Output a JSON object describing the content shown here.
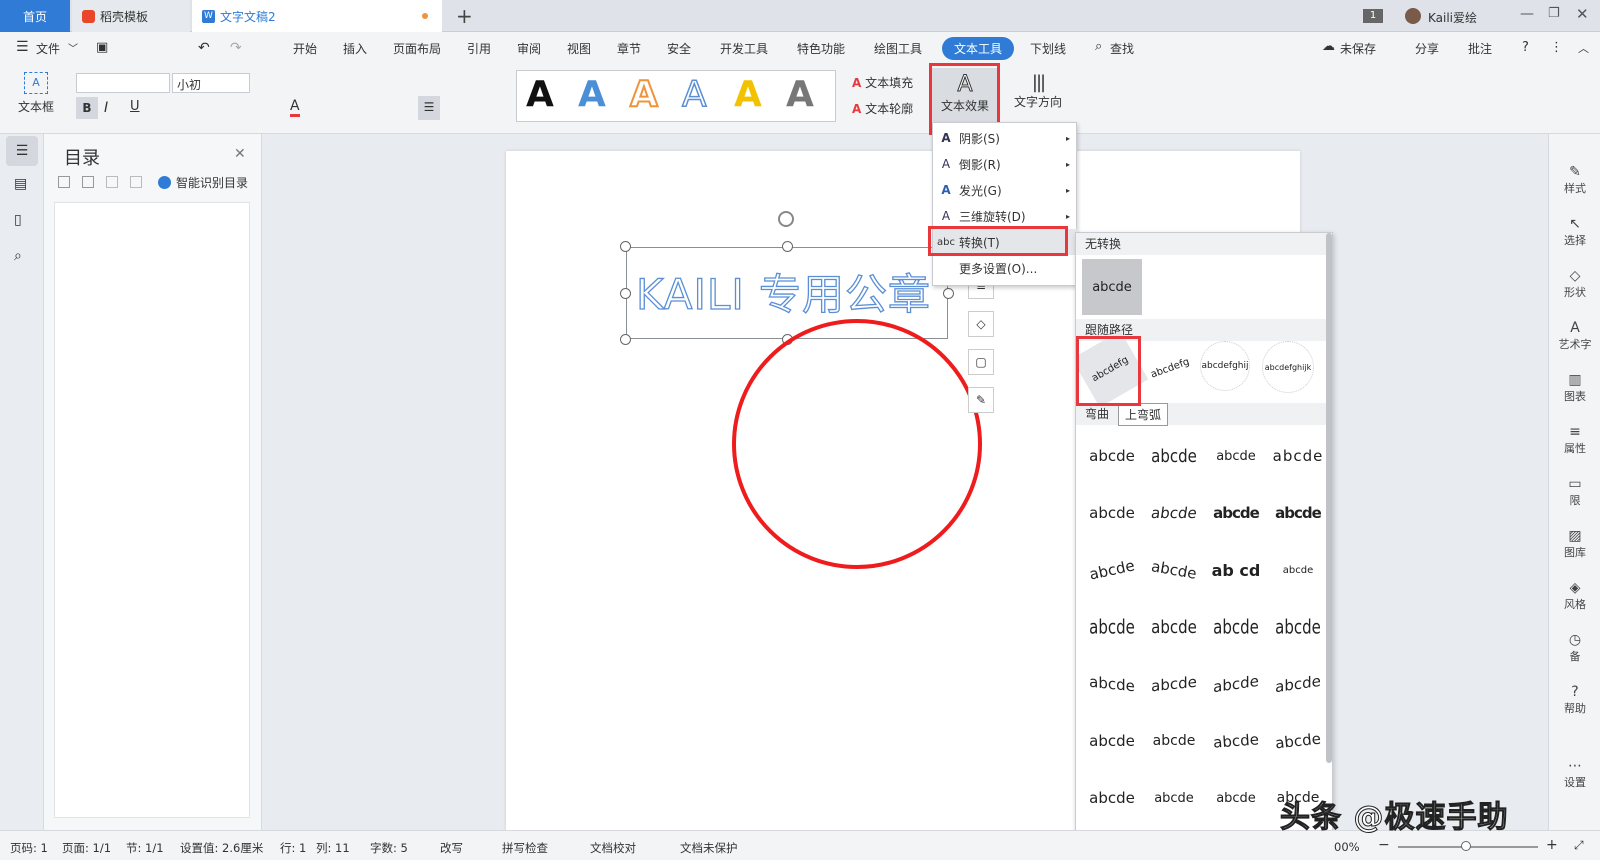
{
  "tabs": [
    {
      "label": "首页"
    },
    {
      "label": "稻壳模板"
    },
    {
      "label": "文字文稿2"
    }
  ],
  "window": {
    "badge": "1",
    "user": "Kaili爱绘"
  },
  "menu": {
    "file": "文件",
    "items": [
      "开始",
      "插入",
      "页面布局",
      "引用",
      "审阅",
      "视图",
      "章节",
      "安全",
      "开发工具",
      "特色功能",
      "绘图工具",
      "文本工具",
      "下划线"
    ],
    "search": "查找",
    "unsaved": "未保存",
    "share": "分享",
    "comment": "批注"
  },
  "ribbon": {
    "textbox": "文本框",
    "font_size": "小初",
    "text_fill": "文本填充",
    "text_outline": "文本轮廓",
    "text_effect": "文本效果",
    "text_direction": "文字方向",
    "art_letters": [
      "A",
      "A",
      "A",
      "A",
      "A",
      "A"
    ],
    "art_colors": [
      "#111111",
      "#4b8fd6",
      "#f0943a",
      "#5a8fd6",
      "#f2c200",
      "#777777"
    ]
  },
  "toc": {
    "title": "目录",
    "smart": "智能识别目录"
  },
  "doc": {
    "art_text": "KAILI 专用公章"
  },
  "effect_menu": {
    "items": [
      "阴影(S)",
      "倒影(R)",
      "发光(G)",
      "三维旋转(D)",
      "转换(T)",
      "更多设置(O)..."
    ]
  },
  "gallery": {
    "no_transform": "无转换",
    "no_transform_sample": "abcde",
    "follow_path": "跟随路径",
    "warp": "弯曲",
    "tooltip": "上弯弧",
    "path_samples": [
      "abcdefg",
      "abcdefg",
      "abcdefghij",
      "abcdefghijk"
    ],
    "warp_rows": [
      [
        "abcde",
        "abcde",
        "abcde",
        "abcde"
      ],
      [
        "abcde",
        "abcde",
        "abcde",
        "abcde"
      ],
      [
        "abcde",
        "abcde",
        "ab cd",
        "abcde"
      ],
      [
        "abcde",
        "abcde",
        "abcde",
        "abcde"
      ],
      [
        "abcde",
        "abcde",
        "abcde",
        "abcde"
      ],
      [
        "abcde",
        "abcde",
        "abcde",
        "abcde"
      ],
      [
        "abcde",
        "abcde",
        "abcde",
        "abcde"
      ]
    ]
  },
  "right_panel": [
    "样式",
    "选择",
    "形状",
    "艺术字",
    "图表",
    "属性",
    "限",
    "图库",
    "风格",
    "备",
    "帮助",
    "设置"
  ],
  "status": {
    "page": "页码: 1",
    "pages": "页面: 1/1",
    "section": "节: 1/1",
    "setting": "设置值: 2.6厘米",
    "row": "行: 1",
    "col": "列: 11",
    "words": "字数: 5",
    "revise": "改写",
    "spell": "拼写检查",
    "proof": "文档校对",
    "protect": "文档未保护",
    "zoom": "00%"
  },
  "watermark": "头条 @极速手助"
}
